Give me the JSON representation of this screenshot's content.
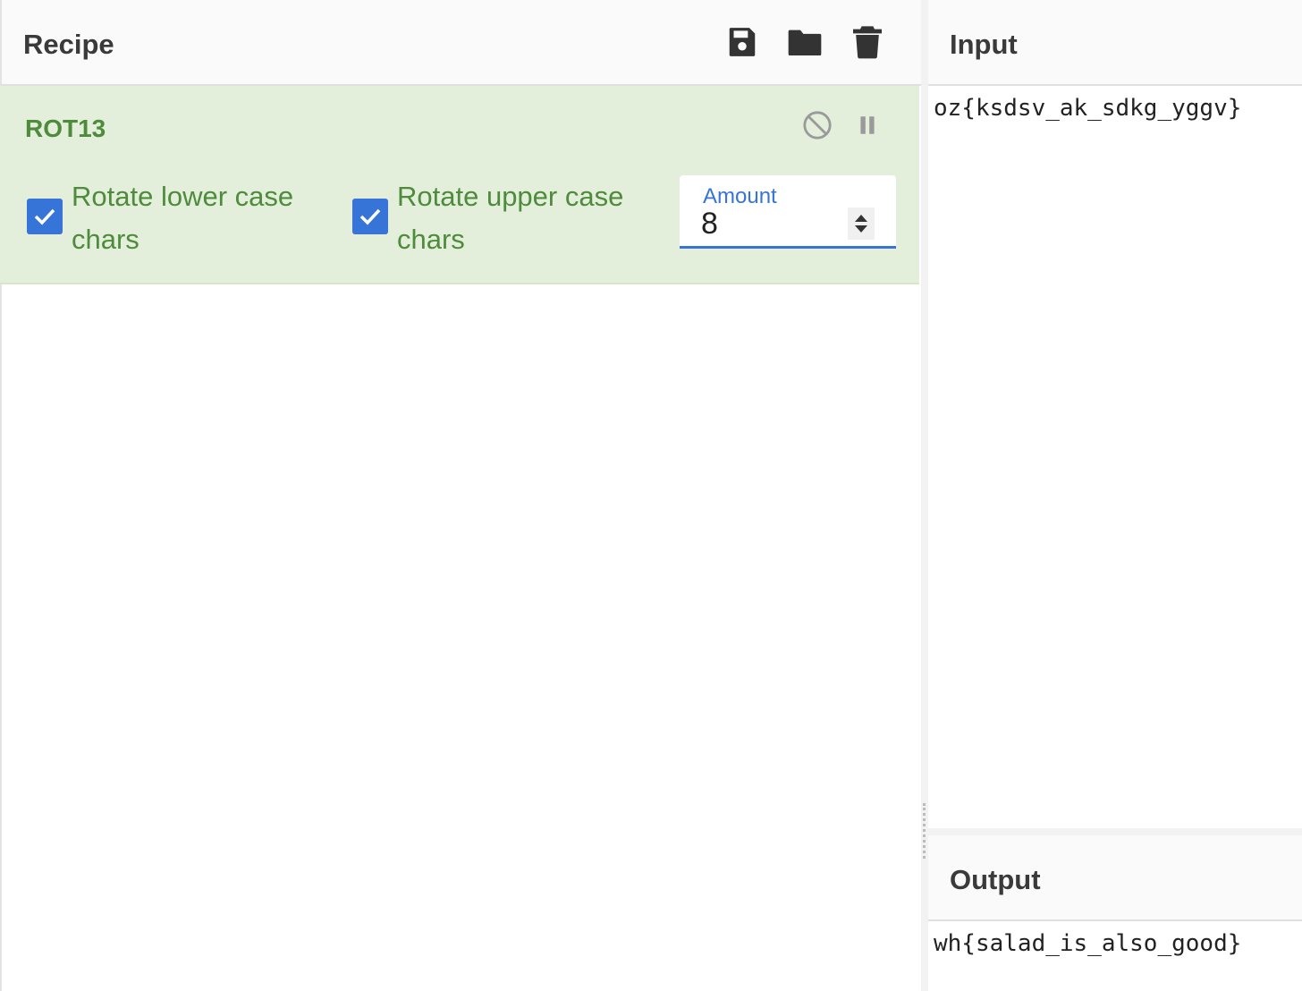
{
  "recipe": {
    "title": "Recipe",
    "icons": [
      "save-icon",
      "folder-icon",
      "trash-icon"
    ]
  },
  "operation": {
    "name": "ROT13",
    "controls": [
      "disable-icon",
      "pause-icon"
    ],
    "options": [
      {
        "label": "Rotate lower case chars",
        "checked": true
      },
      {
        "label": "Rotate upper case chars",
        "checked": true
      }
    ],
    "amount": {
      "label": "Amount",
      "value": "8"
    }
  },
  "input": {
    "title": "Input",
    "text": "oz{ksdsv_ak_sdkg_yggv}"
  },
  "output": {
    "title": "Output",
    "text": "wh{salad_is_also_good}"
  },
  "colors": {
    "accent": "#3774d7",
    "op_green": "#4f8b3c",
    "op_bg": "#e3efdb"
  }
}
